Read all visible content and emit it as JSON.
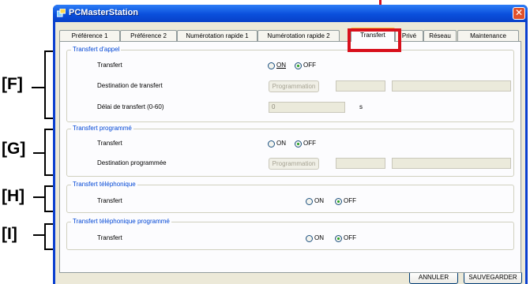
{
  "window": {
    "title": "PCMasterStation",
    "close_glyph": "✕"
  },
  "callouts": [
    "[F]",
    "[G]",
    "[H]",
    "[I]"
  ],
  "tabs": [
    {
      "label": "Préférence 1",
      "active": false
    },
    {
      "label": "Préférence 2",
      "active": false
    },
    {
      "label": "Numérotation rapide 1",
      "active": false
    },
    {
      "label": "Numérotation rapide 2",
      "active": false
    },
    {
      "label": "Transfert",
      "active": true
    },
    {
      "label": "Privé",
      "active": false
    },
    {
      "label": "Réseau",
      "active": false
    },
    {
      "label": "Maintenance",
      "active": false
    }
  ],
  "groups": {
    "call_transfer": {
      "legend": "Transfert d'appel",
      "transfer_label": "Transfert",
      "on_label": "ON",
      "off_label": "OFF",
      "selected": "OFF",
      "destination_label": "Destination de transfert",
      "programming_button": "Programmation",
      "delay_label": "Délai de transfert (0-60)",
      "delay_value": "0",
      "delay_unit": "s"
    },
    "scheduled_transfer": {
      "legend": "Transfert programmé",
      "transfer_label": "Transfert",
      "on_label": "ON",
      "off_label": "OFF",
      "selected": "OFF",
      "destination_label": "Destination programmée",
      "programming_button": "Programmation"
    },
    "phone_transfer": {
      "legend": "Transfert téléphonique",
      "transfer_label": "Transfert",
      "on_label": "ON",
      "off_label": "OFF",
      "selected": "OFF"
    },
    "scheduled_phone_transfer": {
      "legend": "Transfert téléphonique programmé",
      "transfer_label": "Transfert",
      "on_label": "ON",
      "off_label": "OFF",
      "selected": "OFF"
    }
  },
  "footer": {
    "cancel": "ANNULER",
    "save": "SAUVEGARDER"
  },
  "colors": {
    "callout_red": "#d8101c",
    "titlebar_blue": "#0a4fdc",
    "legend_blue": "#0046d5",
    "radio_green": "#21a121"
  }
}
